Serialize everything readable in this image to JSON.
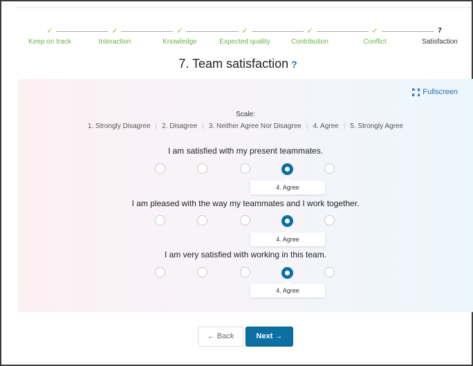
{
  "stepper": {
    "steps": [
      {
        "label": "Keep on track",
        "status": "complete",
        "mark": "✓"
      },
      {
        "label": "Interaction",
        "status": "complete",
        "mark": "✓"
      },
      {
        "label": "Knowledge",
        "status": "complete",
        "mark": "✓"
      },
      {
        "label": "Expected quality",
        "status": "complete",
        "mark": "✓"
      },
      {
        "label": "Contribution",
        "status": "complete",
        "mark": "✓"
      },
      {
        "label": "Conflict",
        "status": "complete",
        "mark": "✓"
      },
      {
        "label": "Satisfaction",
        "status": "current",
        "mark": "7"
      }
    ]
  },
  "page": {
    "title": "7. Team satisfaction",
    "help_icon": "?"
  },
  "panel": {
    "fullscreen_label": "Fullscreen",
    "fullscreen_icon": "expand-icon",
    "scale_title": "Scale:",
    "scale_options": [
      "1. Strongly Disagree",
      "2. Disagree",
      "3. Neither Agree Nor Disagree",
      "4. Agree",
      "5. Strongly Agree"
    ],
    "questions": [
      {
        "text": "I am satisfied with my present teammates.",
        "selected": 4,
        "answer_label": "4. Agree"
      },
      {
        "text": "I am pleased with the way my teammates and I work together.",
        "selected": 4,
        "answer_label": "4. Agree"
      },
      {
        "text": "I am very satisfied with working in this team.",
        "selected": 4,
        "answer_label": "4. Agree"
      }
    ]
  },
  "nav": {
    "back_label": "← Back",
    "next_label": "Next →"
  },
  "colors": {
    "accent": "#0b6fa3",
    "complete_green": "#6ab04c",
    "panel_left": "#fdf0f3",
    "panel_right": "#ecf6fd"
  }
}
